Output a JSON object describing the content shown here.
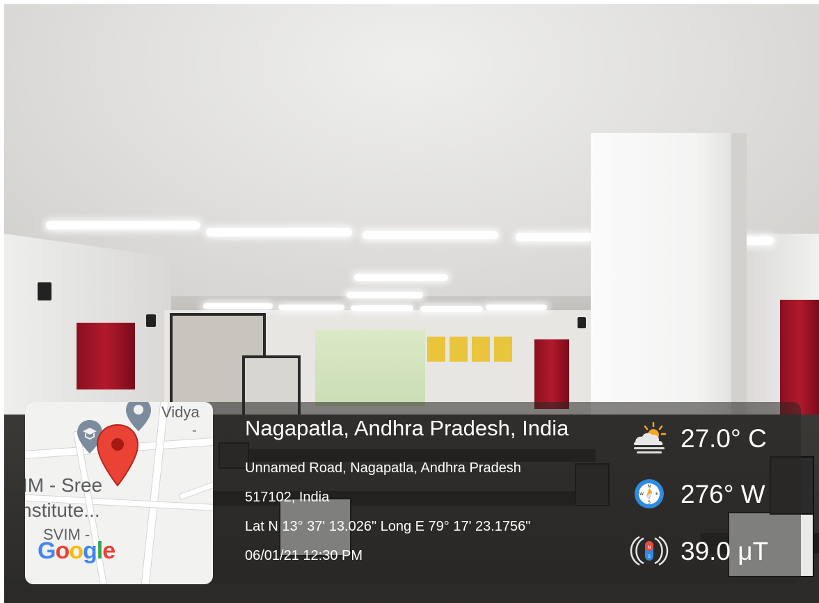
{
  "map": {
    "labels": {
      "vidya": "Vidya",
      "dash": "-",
      "sree": "IM - Sree",
      "institute": "nstitute...",
      "svim": "SVIM -"
    },
    "logo": [
      "G",
      "o",
      "o",
      "g",
      "l",
      "e"
    ]
  },
  "location": {
    "title": "Nagapatla, Andhra Pradesh, India",
    "address_line1": "Unnamed Road, Nagapatla, Andhra Pradesh",
    "address_line2": "517102, India",
    "coordinates": "Lat N 13° 37' 13.026\" Long E 79° 17' 23.1756\"",
    "datetime": "06/01/21 12:30 PM"
  },
  "stats": {
    "temperature": "27.0° C",
    "bearing": "276° W",
    "magnetic": "39.0 μT"
  },
  "icons": {
    "weather": "partly-cloudy-icon",
    "compass": "compass-icon",
    "magnet": "magnetic-field-icon",
    "pin": "location-pin-icon"
  }
}
